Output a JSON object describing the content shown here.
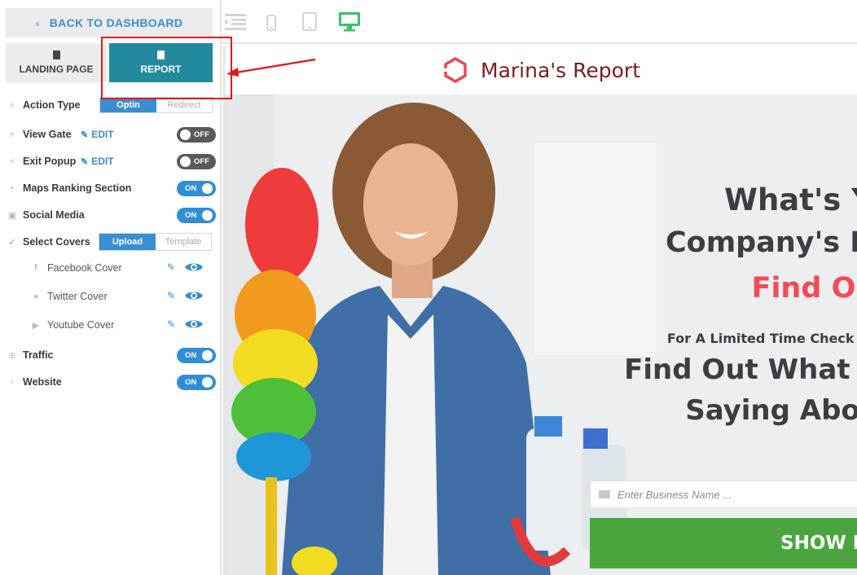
{
  "sidebar": {
    "back_label": "BACK TO DASHBOARD",
    "tabs": [
      {
        "label": "LANDING PAGE",
        "icon": "document-icon",
        "active": false
      },
      {
        "label": "REPORT",
        "icon": "document-icon",
        "active": true
      }
    ],
    "settings": {
      "action_type": {
        "label": "Action Type",
        "options": [
          "Optin",
          "Redirect"
        ],
        "selected": "Optin"
      },
      "view_gate": {
        "label": "View Gate",
        "edit": "EDIT",
        "state": "OFF"
      },
      "exit_popup": {
        "label": "Exit Popup",
        "edit": "EDIT",
        "state": "OFF"
      },
      "maps_ranking": {
        "label": "Maps Ranking Section",
        "state": "ON"
      },
      "social_media": {
        "label": "Social Media",
        "state": "ON"
      },
      "select_covers": {
        "label": "Select Covers",
        "options": [
          "Upload",
          "Template"
        ],
        "selected": "Upload"
      },
      "covers": [
        {
          "label": "Facebook Cover",
          "icon": "facebook-icon"
        },
        {
          "label": "Twitter Cover",
          "icon": "twitter-icon"
        },
        {
          "label": "Youtube Cover",
          "icon": "youtube-icon"
        }
      ],
      "traffic": {
        "label": "Traffic",
        "state": "ON"
      },
      "website": {
        "label": "Website",
        "state": "ON"
      }
    }
  },
  "devices": [
    "outline-icon",
    "phone-icon",
    "tablet-icon",
    "desktop-icon"
  ],
  "active_device": "desktop-icon",
  "preview": {
    "brand": "Marina's Report",
    "headline_1": "What's Yo",
    "headline_2": "Company's Re",
    "headline_3": "Find Out",
    "subline": "For A Limited Time Check I",
    "headline_4": "Find Out What Y",
    "headline_5": "Saying Abou",
    "input_placeholder": "Enter Business Name ...",
    "button_label": "SHOW M"
  },
  "colors": {
    "accent_blue": "#3a8fd0",
    "report_tab": "#238a9e",
    "annotation_red": "#e8161c",
    "brand_red": "#7d1b21",
    "headline_red": "#f24b57",
    "button_green": "#4aa53f",
    "desktop_active": "#3cbf6c"
  }
}
